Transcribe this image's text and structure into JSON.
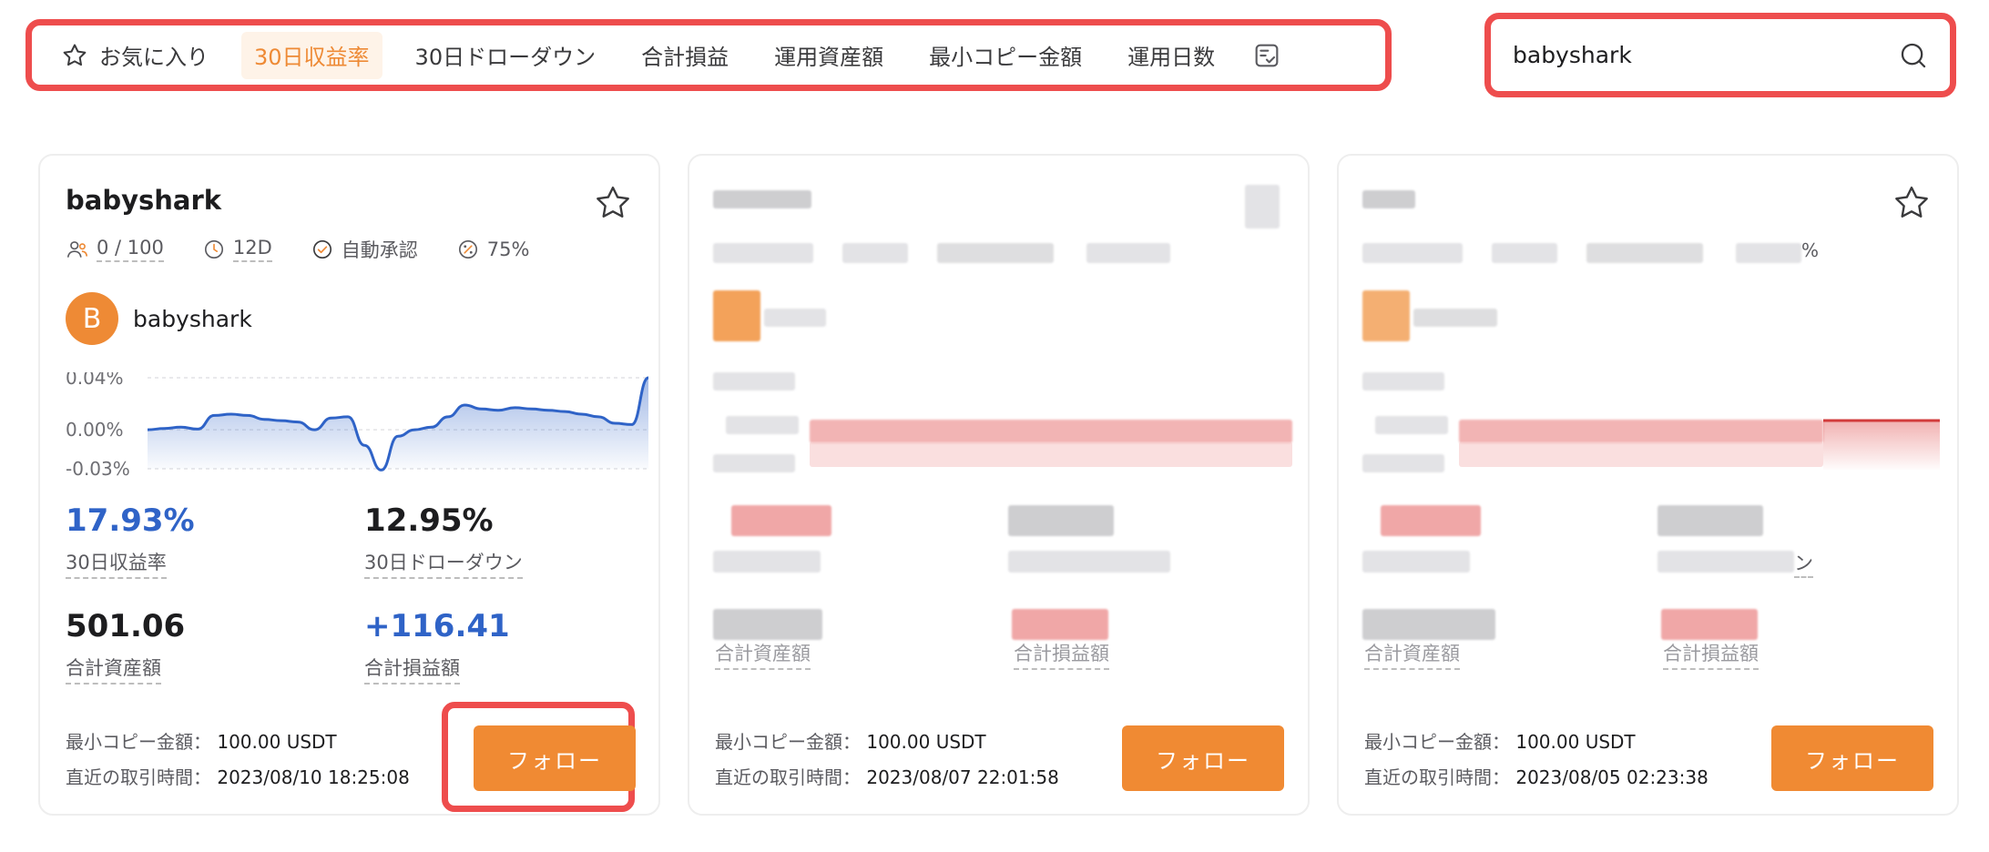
{
  "filters": {
    "favorites": "お気に入り",
    "tabs": [
      "30日収益率",
      "30日ドローダウン",
      "合計損益",
      "運用資産額",
      "最小コピー金額",
      "運用日数"
    ],
    "active_tab": "30日収益率"
  },
  "search": {
    "value": "babyshark"
  },
  "colors": {
    "accent": "#f08a33",
    "highlight": "#ee4d4d",
    "positive": "#2f63c7",
    "chart_line": "#2f63c7"
  },
  "cards": [
    {
      "title": "babyshark",
      "followers": "0 / 100",
      "days": "12D",
      "auto_approve": "自動承認",
      "profit_share": "75%",
      "avatar_letter": "B",
      "profile_name": "babyshark",
      "roi_30d": "17.93%",
      "roi_30d_label": "30日収益率",
      "drawdown_30d": "12.95%",
      "drawdown_30d_label": "30日ドローダウン",
      "total_assets": "501.06",
      "total_assets_label": "合計資産額",
      "total_pnl": "+116.41",
      "total_pnl_label": "合計損益額",
      "min_copy_label": "最小コピー金額：",
      "min_copy_value": "100.00 USDT",
      "last_trade_label": "直近の取引時間：",
      "last_trade_value": "2023/08/10 18:25:08",
      "follow_label": "フォロー"
    },
    {
      "title": "",
      "total_assets_label": "合計資産額",
      "total_pnl_label": "合計損益額",
      "min_copy_label": "最小コピー金額：",
      "min_copy_value": "100.00 USDT",
      "last_trade_label": "直近の取引時間：",
      "last_trade_value": "2023/08/07 22:01:58",
      "follow_label": "フォロー"
    },
    {
      "title": "",
      "total_assets_label": "合計資産額",
      "total_pnl_label": "合計損益額",
      "drawdown_30d_label_partial": "ン",
      "profit_share_partial": "%",
      "min_copy_label": "最小コピー金額：",
      "min_copy_value": "100.00 USDT",
      "last_trade_label": "直近の取引時間：",
      "last_trade_value": "2023/08/05 02:23:38",
      "follow_label": "フォロー"
    }
  ],
  "chart_data": {
    "type": "area",
    "title": "",
    "xlabel": "",
    "ylabel": "",
    "y_ticks": [
      "0.04%",
      "0.00%",
      "-0.03%"
    ],
    "ylim": [
      -0.03,
      0.04
    ],
    "grid": true,
    "series": [
      {
        "values": [
          0.0,
          0.001,
          0.002,
          0.0005,
          0.011,
          0.012,
          0.011,
          0.008,
          0.007,
          0.006,
          0.0,
          0.009,
          0.01,
          -0.012,
          -0.031,
          -0.005,
          0.0,
          0.002,
          0.01,
          0.019,
          0.016,
          0.015,
          0.017,
          0.016,
          0.015,
          0.014,
          0.012,
          0.01,
          0.005,
          0.004,
          0.04
        ]
      }
    ]
  }
}
